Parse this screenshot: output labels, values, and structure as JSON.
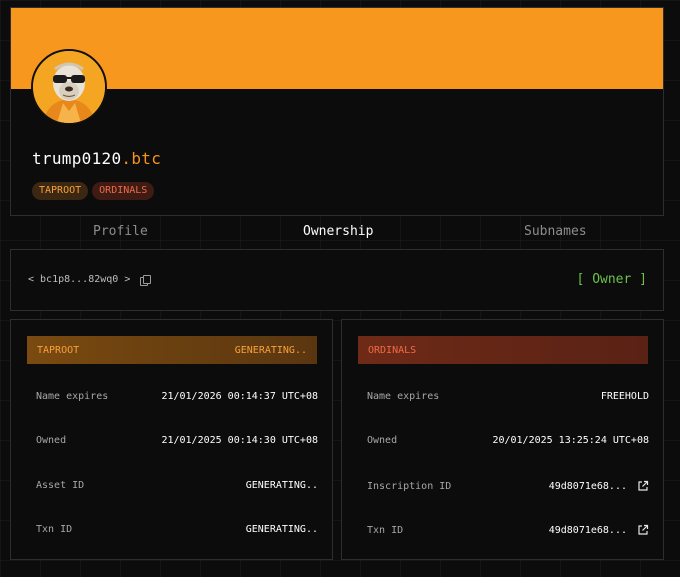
{
  "profile": {
    "name": "trump0120",
    "tld": ".btc",
    "tags": [
      "TAPROOT",
      "ORDINALS"
    ],
    "banner_color": "#f7971e"
  },
  "tabs": [
    {
      "label": "Profile",
      "active": false
    },
    {
      "label": "Ownership",
      "active": true
    },
    {
      "label": "Subnames",
      "active": false
    }
  ],
  "address_bar": {
    "prev": "<",
    "address": "bc1p8...82wq0",
    "next": ">",
    "copy_icon": "copy-icon",
    "owner_label": "[ Owner ]",
    "owner_color": "#6cc24a"
  },
  "taproot": {
    "title": "TAPROOT",
    "status": "GENERATING..",
    "rows": [
      {
        "label": "Name expires",
        "value": "21/01/2026 00:14:37 UTC+08"
      },
      {
        "label": "Owned",
        "value": "21/01/2025 00:14:30 UTC+08"
      },
      {
        "label": "Asset ID",
        "value": "GENERATING.."
      },
      {
        "label": "Txn ID",
        "value": "GENERATING.."
      }
    ]
  },
  "ordinals": {
    "title": "ORDINALS",
    "rows": [
      {
        "label": "Name expires",
        "value": "FREEHOLD"
      },
      {
        "label": "Owned",
        "value": "20/01/2025 13:25:24 UTC+08"
      },
      {
        "label": "Inscription ID",
        "value": "49d8071e68...",
        "icon": "external-link-icon"
      },
      {
        "label": "Txn ID",
        "value": "49d8071e68...",
        "icon": "external-link-icon"
      }
    ]
  }
}
